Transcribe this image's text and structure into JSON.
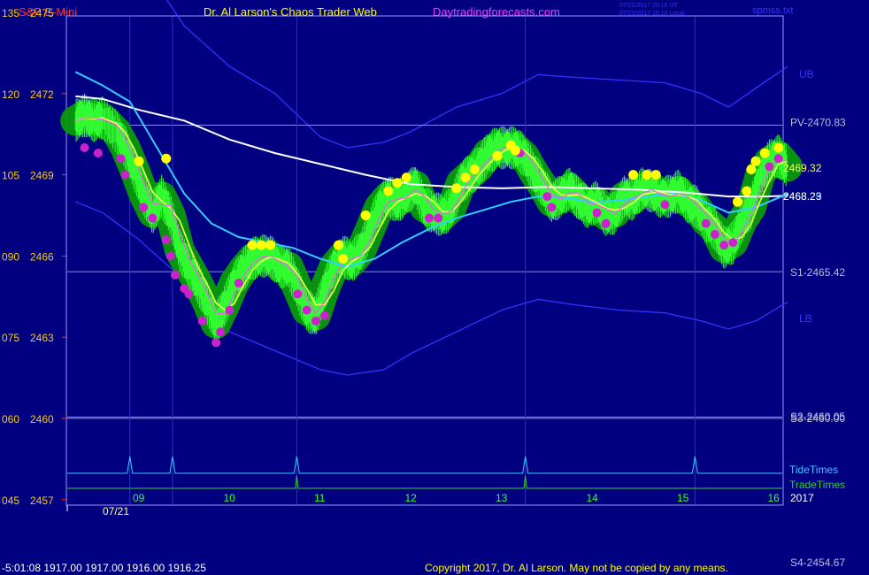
{
  "header": {
    "instrument": "S&P E-Mini",
    "title": "Dr. Al Larson's Chaos Trader Web",
    "site": "Daytradingforecasts.com",
    "timestamp_utc": "07/21/2017 20:16 UT",
    "timestamp_local": "07/21/2017 15:16 Local",
    "file": "spmss.txt"
  },
  "footer": {
    "ohlc": "-5:01:08  1917.00 1917.00 1916.00 1916.25",
    "copyright": "Copyright 2017, Dr. Al Larson. May not be copied by any means.",
    "s4": "S4-2454.67"
  },
  "colors": {
    "background": "#000080",
    "frame": "#9999ff",
    "price_bars": "#33ff33",
    "glow": "#0a9a0a",
    "magenta_dots": "#cc22cc",
    "yellow_dots": "#ffff00",
    "envelope": "#3333ff",
    "cyan_ma": "#33ccff",
    "white_ma": "#ffffff",
    "yellow_ma": "#ffff55",
    "magenta_ma": "#ff55ff",
    "level_line": "#bbbbdd",
    "tide": "#33ccff",
    "trade": "#33cc33",
    "left_axis_text": "#ffcc00",
    "hour_text": "#33ff33"
  },
  "chart_data": {
    "type": "line",
    "x_unit": "hour of day (ET), 07/21/2017",
    "date_label": "07/21",
    "year_label": "2017",
    "x_ticks": [
      "09",
      "10",
      "11",
      "12",
      "13",
      "14",
      "15",
      "16"
    ],
    "y_ticks": [
      {
        "left": "135",
        "price": "2475",
        "value": 2475
      },
      {
        "left": "120",
        "price": "2472",
        "value": 2472
      },
      {
        "left": "105",
        "price": "2469",
        "value": 2469
      },
      {
        "left": "090",
        "price": "2466",
        "value": 2466
      },
      {
        "left": "075",
        "price": "2463",
        "value": 2463
      },
      {
        "left": "060",
        "price": "2460",
        "value": 2460
      },
      {
        "left": "045",
        "price": "2457",
        "value": 2457
      }
    ],
    "levels": [
      {
        "label": "PV-2470.83",
        "value": 2470.83
      },
      {
        "label": "S1-2465.42",
        "value": 2465.42
      },
      {
        "label": "S2-2460.05",
        "value": 2460.05
      },
      {
        "label": "S3-2460.00",
        "value": 2460.0
      }
    ],
    "band_labels": [
      "UB",
      "LB"
    ],
    "last_labels": [
      {
        "label": "2469.32",
        "value": 2469.32
      },
      {
        "label": "2468.29",
        "value": 2468.29
      },
      {
        "label": "2468.23",
        "value": 2468.23
      }
    ],
    "vertical_time_lines": [
      8.9,
      9.37,
      10.74,
      13.26,
      15.13
    ],
    "tide_times": [
      8.9,
      9.37,
      10.74,
      13.26,
      15.13
    ],
    "trade_times": [
      10.74,
      13.26
    ],
    "timing_labels": [
      "TideTimes",
      "TradeTimes"
    ],
    "series": [
      {
        "key": "price",
        "points": [
          [
            8.3,
            2471.0
          ],
          [
            8.4,
            2471.2
          ],
          [
            8.5,
            2471.0
          ],
          [
            8.6,
            2471.1
          ],
          [
            8.75,
            2470.6
          ],
          [
            8.85,
            2470.0
          ],
          [
            8.95,
            2469.2
          ],
          [
            9.05,
            2468.3
          ],
          [
            9.15,
            2467.6
          ],
          [
            9.25,
            2468.2
          ],
          [
            9.35,
            2467.5
          ],
          [
            9.45,
            2466.2
          ],
          [
            9.55,
            2465.6
          ],
          [
            9.65,
            2465.0
          ],
          [
            9.75,
            2464.3
          ],
          [
            9.85,
            2463.5
          ],
          [
            9.95,
            2464.2
          ],
          [
            10.05,
            2465.0
          ],
          [
            10.15,
            2465.5
          ],
          [
            10.25,
            2465.9
          ],
          [
            10.35,
            2466.0
          ],
          [
            10.45,
            2466.0
          ],
          [
            10.55,
            2465.6
          ],
          [
            10.65,
            2465.6
          ],
          [
            10.75,
            2464.8
          ],
          [
            10.85,
            2464.0
          ],
          [
            10.95,
            2463.8
          ],
          [
            11.05,
            2464.8
          ],
          [
            11.15,
            2465.6
          ],
          [
            11.25,
            2466.0
          ],
          [
            11.35,
            2465.8
          ],
          [
            11.45,
            2466.2
          ],
          [
            11.55,
            2467.0
          ],
          [
            11.65,
            2467.8
          ],
          [
            11.75,
            2468.2
          ],
          [
            11.85,
            2468.0
          ],
          [
            11.95,
            2468.3
          ],
          [
            12.05,
            2468.6
          ],
          [
            12.15,
            2467.8
          ],
          [
            12.25,
            2467.6
          ],
          [
            12.35,
            2467.5
          ],
          [
            12.45,
            2467.8
          ],
          [
            12.55,
            2468.7
          ],
          [
            12.65,
            2469.0
          ],
          [
            12.75,
            2469.3
          ],
          [
            12.85,
            2469.8
          ],
          [
            12.95,
            2470.0
          ],
          [
            13.05,
            2470.0
          ],
          [
            13.15,
            2470.0
          ],
          [
            13.25,
            2469.7
          ],
          [
            13.35,
            2469.1
          ],
          [
            13.45,
            2468.6
          ],
          [
            13.55,
            2468.0
          ],
          [
            13.65,
            2468.2
          ],
          [
            13.75,
            2468.5
          ],
          [
            13.85,
            2468.1
          ],
          [
            13.95,
            2467.8
          ],
          [
            14.05,
            2468.0
          ],
          [
            14.15,
            2467.5
          ],
          [
            14.25,
            2467.6
          ],
          [
            14.35,
            2468.2
          ],
          [
            14.45,
            2468.1
          ],
          [
            14.55,
            2468.5
          ],
          [
            14.65,
            2468.4
          ],
          [
            14.75,
            2468.2
          ],
          [
            14.85,
            2468.2
          ],
          [
            14.95,
            2468.4
          ],
          [
            15.05,
            2468.0
          ],
          [
            15.15,
            2467.8
          ],
          [
            15.25,
            2467.3
          ],
          [
            15.35,
            2467.0
          ],
          [
            15.45,
            2466.3
          ],
          [
            15.55,
            2466.5
          ],
          [
            15.65,
            2467.3
          ],
          [
            15.75,
            2467.8
          ],
          [
            15.85,
            2469.0
          ],
          [
            15.95,
            2469.5
          ],
          [
            16.05,
            2469.7
          ],
          [
            16.15,
            2469.3
          ]
        ]
      },
      {
        "key": "white_ma",
        "points": [
          [
            8.3,
            2471.9
          ],
          [
            8.6,
            2471.8
          ],
          [
            9.0,
            2471.4
          ],
          [
            9.5,
            2471.0
          ],
          [
            10.0,
            2470.3
          ],
          [
            10.5,
            2469.8
          ],
          [
            11.0,
            2469.4
          ],
          [
            11.5,
            2469.0
          ],
          [
            12.0,
            2468.65
          ],
          [
            12.5,
            2468.55
          ],
          [
            13.0,
            2468.5
          ],
          [
            13.5,
            2468.55
          ],
          [
            14.0,
            2468.5
          ],
          [
            14.5,
            2468.45
          ],
          [
            15.0,
            2468.35
          ],
          [
            15.5,
            2468.2
          ],
          [
            15.9,
            2468.2
          ],
          [
            16.15,
            2468.23
          ]
        ]
      },
      {
        "key": "cyan_ma",
        "points": [
          [
            8.3,
            2472.8
          ],
          [
            8.6,
            2472.3
          ],
          [
            8.9,
            2471.7
          ],
          [
            9.2,
            2470.0
          ],
          [
            9.5,
            2468.3
          ],
          [
            9.8,
            2467.2
          ],
          [
            10.1,
            2466.7
          ],
          [
            10.4,
            2466.5
          ],
          [
            10.7,
            2466.3
          ],
          [
            11.0,
            2465.9
          ],
          [
            11.3,
            2465.6
          ],
          [
            11.6,
            2465.9
          ],
          [
            11.9,
            2466.5
          ],
          [
            12.2,
            2467.0
          ],
          [
            12.5,
            2467.4
          ],
          [
            12.8,
            2467.7
          ],
          [
            13.1,
            2468.0
          ],
          [
            13.4,
            2468.2
          ],
          [
            13.7,
            2468.15
          ],
          [
            14.0,
            2468.0
          ],
          [
            14.3,
            2468.05
          ],
          [
            14.6,
            2468.2
          ],
          [
            14.9,
            2468.3
          ],
          [
            15.2,
            2468.05
          ],
          [
            15.5,
            2467.6
          ],
          [
            15.8,
            2467.8
          ],
          [
            16.15,
            2468.29
          ]
        ]
      },
      {
        "key": "upper_band",
        "points": [
          [
            8.3,
            2477.5
          ],
          [
            8.6,
            2477.0
          ],
          [
            9.0,
            2476.0
          ],
          [
            9.3,
            2475.5
          ],
          [
            9.5,
            2474.5
          ],
          [
            10.0,
            2473.0
          ],
          [
            10.5,
            2472.0
          ],
          [
            11.0,
            2470.4
          ],
          [
            11.3,
            2470.0
          ],
          [
            11.7,
            2470.2
          ],
          [
            12.0,
            2470.6
          ],
          [
            12.5,
            2471.5
          ],
          [
            13.0,
            2472.0
          ],
          [
            13.4,
            2472.7
          ],
          [
            13.8,
            2472.6
          ],
          [
            14.3,
            2472.5
          ],
          [
            14.8,
            2472.4
          ],
          [
            15.2,
            2472.0
          ],
          [
            15.5,
            2471.5
          ],
          [
            15.8,
            2472.2
          ],
          [
            16.15,
            2473.0
          ]
        ]
      },
      {
        "key": "lower_band",
        "points": [
          [
            8.3,
            2468.0
          ],
          [
            8.6,
            2467.6
          ],
          [
            9.0,
            2466.6
          ],
          [
            9.5,
            2465.1
          ],
          [
            10.0,
            2463.2
          ],
          [
            10.5,
            2462.5
          ],
          [
            11.0,
            2461.8
          ],
          [
            11.3,
            2461.6
          ],
          [
            11.7,
            2461.8
          ],
          [
            12.0,
            2462.4
          ],
          [
            12.5,
            2463.2
          ],
          [
            13.0,
            2464.0
          ],
          [
            13.4,
            2464.4
          ],
          [
            13.8,
            2464.2
          ],
          [
            14.3,
            2464.0
          ],
          [
            14.8,
            2463.9
          ],
          [
            15.2,
            2463.6
          ],
          [
            15.5,
            2463.3
          ],
          [
            15.8,
            2463.6
          ],
          [
            16.15,
            2464.3
          ]
        ]
      }
    ],
    "yellow_dots": [
      [
        9.0,
        2469.5
      ],
      [
        9.3,
        2469.6
      ],
      [
        10.25,
        2466.4
      ],
      [
        10.35,
        2466.4
      ],
      [
        10.45,
        2466.4
      ],
      [
        11.2,
        2466.4
      ],
      [
        11.25,
        2465.9
      ],
      [
        11.5,
        2467.5
      ],
      [
        11.75,
        2468.4
      ],
      [
        11.85,
        2468.7
      ],
      [
        11.95,
        2468.9
      ],
      [
        12.5,
        2468.5
      ],
      [
        12.6,
        2468.9
      ],
      [
        12.7,
        2469.2
      ],
      [
        12.95,
        2469.7
      ],
      [
        13.1,
        2470.1
      ],
      [
        13.15,
        2469.9
      ],
      [
        14.45,
        2469.0
      ],
      [
        14.6,
        2469.0
      ],
      [
        14.7,
        2469.0
      ],
      [
        15.6,
        2468.0
      ],
      [
        15.7,
        2468.4
      ],
      [
        15.75,
        2469.2
      ],
      [
        15.8,
        2469.5
      ],
      [
        15.9,
        2469.8
      ],
      [
        16.05,
        2470.0
      ]
    ],
    "magenta_dots": [
      [
        8.4,
        2470.0
      ],
      [
        8.55,
        2469.8
      ],
      [
        8.8,
        2469.6
      ],
      [
        8.85,
        2469.0
      ],
      [
        9.05,
        2467.8
      ],
      [
        9.15,
        2467.4
      ],
      [
        9.3,
        2466.6
      ],
      [
        9.35,
        2466.0
      ],
      [
        9.4,
        2465.3
      ],
      [
        9.5,
        2464.8
      ],
      [
        9.55,
        2464.6
      ],
      [
        9.7,
        2463.6
      ],
      [
        9.85,
        2462.8
      ],
      [
        9.9,
        2463.2
      ],
      [
        10.0,
        2464.0
      ],
      [
        10.1,
        2465.0
      ],
      [
        10.75,
        2464.6
      ],
      [
        10.85,
        2464.0
      ],
      [
        10.95,
        2463.6
      ],
      [
        11.05,
        2463.8
      ],
      [
        12.2,
        2467.4
      ],
      [
        12.3,
        2467.4
      ],
      [
        13.2,
        2469.8
      ],
      [
        13.5,
        2468.2
      ],
      [
        13.55,
        2467.8
      ],
      [
        14.05,
        2467.6
      ],
      [
        14.15,
        2467.2
      ],
      [
        14.8,
        2467.9
      ],
      [
        15.25,
        2467.2
      ],
      [
        15.35,
        2466.8
      ],
      [
        15.45,
        2466.4
      ],
      [
        15.55,
        2466.5
      ],
      [
        15.95,
        2469.3
      ],
      [
        16.05,
        2469.6
      ]
    ]
  }
}
